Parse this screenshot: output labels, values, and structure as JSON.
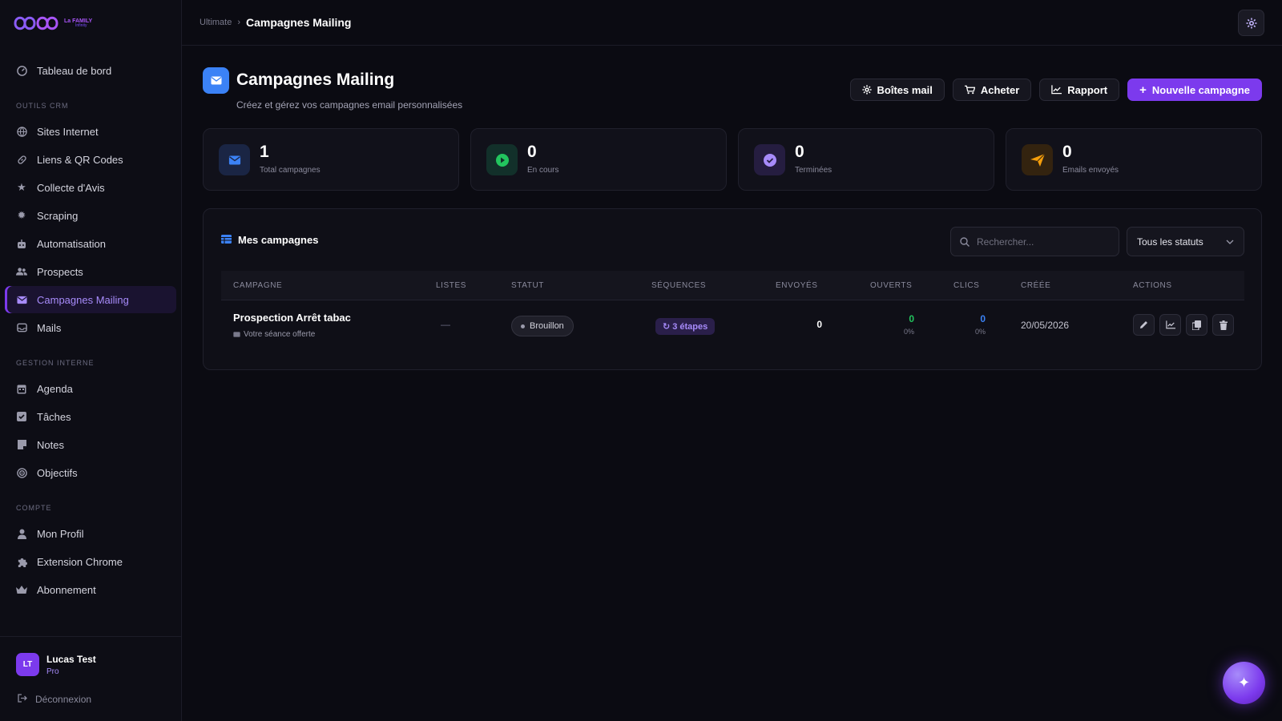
{
  "brand": {
    "line1": "La FAMILY",
    "line2": "Infinity",
    "accent": "#7c3aed"
  },
  "sidebar": {
    "top_item": {
      "label": "Tableau de bord",
      "icon": "dashboard-icon"
    },
    "sections": [
      {
        "title": "OUTILS CRM",
        "items": [
          {
            "label": "Sites Internet",
            "icon": "globe-icon"
          },
          {
            "label": "Liens & QR Codes",
            "icon": "link-icon"
          },
          {
            "label": "Collecte d'Avis",
            "icon": "star-icon"
          },
          {
            "label": "Scraping",
            "icon": "spider-icon"
          },
          {
            "label": "Automatisation",
            "icon": "robot-icon"
          },
          {
            "label": "Prospects",
            "icon": "users-icon"
          },
          {
            "label": "Campagnes Mailing",
            "icon": "envelope-icon",
            "active": true
          },
          {
            "label": "Mails",
            "icon": "inbox-icon"
          }
        ]
      },
      {
        "title": "GESTION INTERNE",
        "items": [
          {
            "label": "Agenda",
            "icon": "calendar-icon"
          },
          {
            "label": "Tâches",
            "icon": "checkbox-icon"
          },
          {
            "label": "Notes",
            "icon": "note-icon"
          },
          {
            "label": "Objectifs",
            "icon": "target-icon"
          }
        ]
      },
      {
        "title": "COMPTE",
        "items": [
          {
            "label": "Mon Profil",
            "icon": "user-icon"
          },
          {
            "label": "Extension Chrome",
            "icon": "puzzle-icon"
          },
          {
            "label": "Abonnement",
            "icon": "crown-icon"
          }
        ]
      }
    ],
    "user": {
      "initials": "LT",
      "name": "Lucas Test",
      "plan": "Pro"
    },
    "logout_label": "Déconnexion"
  },
  "topbar": {
    "breadcrumb_root": "Ultimate",
    "breadcrumb_sep": "›",
    "breadcrumb_current": "Campagnes Mailing"
  },
  "page": {
    "title": "Campagnes Mailing",
    "subtitle": "Créez et gérez vos campagnes email personnalisées",
    "actions": {
      "mailboxes": "Boîtes mail",
      "buy": "Acheter",
      "report": "Rapport",
      "new_campaign": "Nouvelle campagne"
    }
  },
  "stats": [
    {
      "value": "1",
      "label": "Total campagnes",
      "icon": "envelope-icon",
      "color": "#3b82f6",
      "bg": "#1a2544"
    },
    {
      "value": "0",
      "label": "En cours",
      "icon": "play-icon",
      "color": "#22c55e",
      "bg": "#12302a"
    },
    {
      "value": "0",
      "label": "Terminées",
      "icon": "check-circle-icon",
      "color": "#a78bfa",
      "bg": "#251d40"
    },
    {
      "value": "0",
      "label": "Emails envoyés",
      "icon": "paper-plane-icon",
      "color": "#f59e0b",
      "bg": "#33230f"
    }
  ],
  "campaigns": {
    "title": "Mes campagnes",
    "search_placeholder": "Rechercher...",
    "status_filter": "Tous les statuts",
    "columns": [
      "CAMPAGNE",
      "LISTES",
      "STATUT",
      "SÉQUENCES",
      "ENVOYÉS",
      "OUVERTS",
      "CLICS",
      "CRÉÉE",
      "ACTIONS"
    ],
    "rows": [
      {
        "name": "Prospection Arrêt tabac",
        "subject": "Votre séance offerte",
        "lists": "—",
        "status": "Brouillon",
        "sequences": "3 étapes",
        "sent": "0",
        "opened": "0",
        "opened_pct": "0%",
        "clicks": "0",
        "clicks_pct": "0%",
        "created": "20/05/2026"
      }
    ]
  },
  "colors": {
    "opened": "#22c55e",
    "clicks": "#3b82f6"
  }
}
